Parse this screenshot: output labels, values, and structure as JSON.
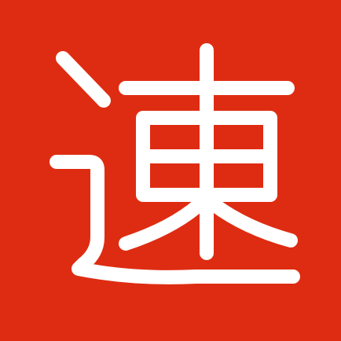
{
  "icon": {
    "character": "速",
    "background_color": "#DE2C12",
    "glyph_color": "#FFFFFF"
  }
}
